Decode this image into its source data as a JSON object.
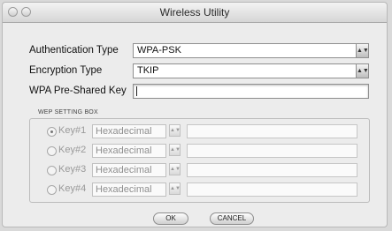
{
  "window": {
    "title": "Wireless Utility"
  },
  "auth": {
    "label": "Authentication Type",
    "value": "WPA-PSK"
  },
  "encryption": {
    "label": "Encryption Type",
    "value": "TKIP"
  },
  "psk": {
    "label": "WPA Pre-Shared Key",
    "value": ""
  },
  "wep": {
    "title": "WEP SETTING BOX",
    "keys": [
      {
        "label": "Key#1",
        "format": "Hexadecimal",
        "value": "",
        "selected": true
      },
      {
        "label": "Key#2",
        "format": "Hexadecimal",
        "value": "",
        "selected": false
      },
      {
        "label": "Key#3",
        "format": "Hexadecimal",
        "value": "",
        "selected": false
      },
      {
        "label": "Key#4",
        "format": "Hexadecimal",
        "value": "",
        "selected": false
      }
    ]
  },
  "buttons": {
    "ok": "OK",
    "cancel": "CANCEL"
  },
  "icons": {
    "dropdown": "dropdown-arrow-icon",
    "window_control": "window-control-icon"
  }
}
